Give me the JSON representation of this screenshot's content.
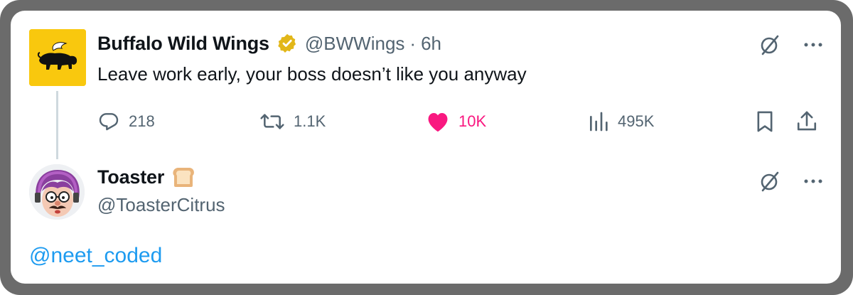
{
  "tweet": {
    "author_name": "Buffalo Wild Wings",
    "handle": "@BWWings",
    "separator": "·",
    "time": "6h",
    "text": "Leave work early, your boss doesn’t like you anyway",
    "stats": {
      "replies": "218",
      "retweets": "1.1K",
      "likes": "10K",
      "views": "495K"
    },
    "liked": true,
    "icons": {
      "grok": "grok-slash-icon",
      "more": "more-dots-icon",
      "reply": "reply-icon",
      "retweet": "retweet-icon",
      "like": "heart-icon",
      "views": "views-bars-icon",
      "bookmark": "bookmark-icon",
      "share": "share-icon",
      "verified": "verified-badge-icon"
    }
  },
  "reply": {
    "author_name": "Toaster",
    "emoji": "🍞",
    "handle": "@ToasterCitrus",
    "text": "@neet_coded"
  },
  "colors": {
    "like_pink": "#f91880",
    "link_blue": "#1d9bf0",
    "muted": "#536471",
    "brand_yellow": "#f9c80e",
    "verified_gold": "#e2b719"
  }
}
